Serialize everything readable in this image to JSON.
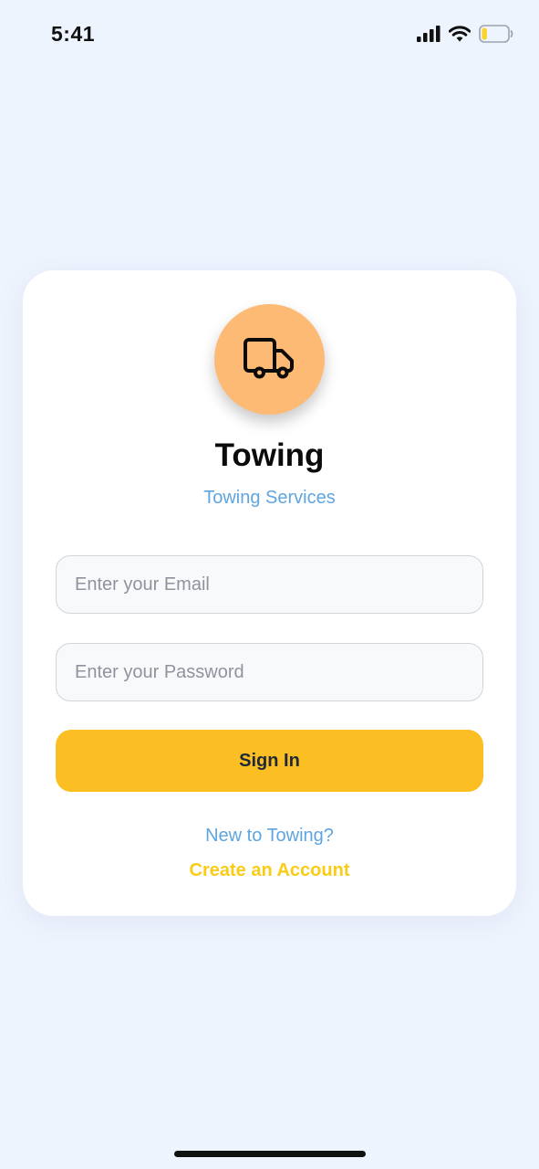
{
  "status_bar": {
    "time": "5:41",
    "icons": [
      "signal-icon",
      "wifi-icon",
      "battery-icon"
    ],
    "battery_level": 0.2,
    "battery_color": "#fbd32a"
  },
  "logo": {
    "icon": "truck-icon",
    "background_color": "#fdba74"
  },
  "app": {
    "title": "Towing",
    "subtitle": "Towing Services"
  },
  "form": {
    "email_placeholder": "Enter your Email",
    "email_value": "",
    "password_placeholder": "Enter your Password",
    "password_value": "",
    "submit_label": "Sign In",
    "submit_color": "#fbbf24"
  },
  "footer": {
    "prompt": "New to Towing?",
    "create_account_label": "Create an Account"
  },
  "colors": {
    "background": "#eef4fe",
    "link_blue": "#5fa5df",
    "accent_yellow": "#facc15"
  }
}
